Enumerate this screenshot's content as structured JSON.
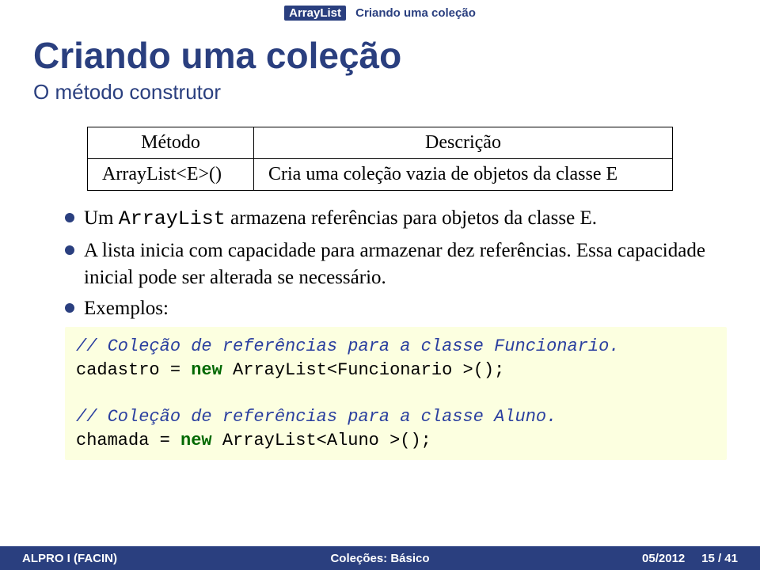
{
  "breadcrumb": {
    "topic": "ArrayList",
    "subtopic": "Criando uma coleção"
  },
  "title": "Criando uma coleção",
  "subtitle": "O método construtor",
  "table": {
    "headers": {
      "method": "Método",
      "desc": "Descrição"
    },
    "row": {
      "method": "ArrayList<E>()",
      "desc": "Cria uma coleção vazia de objetos da classe E"
    }
  },
  "bullets": {
    "b1a": "Um ",
    "b1code": "ArrayList",
    "b1b": " armazena referências para objetos da classe E.",
    "b2": "A lista inicia com capacidade para armazenar dez referências. Essa capacidade inicial pode ser alterada se necessário.",
    "b3": "Exemplos:"
  },
  "code": {
    "c1": "// Coleção de referências para a classe Funcionario.",
    "c2a": "cadastro = ",
    "c2kw": "new",
    "c2b": " ArrayList<Funcionario >();",
    "blank": "",
    "c3": "// Coleção de referências para a classe Aluno.",
    "c4a": "chamada = ",
    "c4kw": "new",
    "c4b": " ArrayList<Aluno >();"
  },
  "footer": {
    "left": "ALPRO I (FACIN)",
    "mid": "Coleções: Básico",
    "right_date": "05/2012",
    "right_page": "15 / 41"
  }
}
